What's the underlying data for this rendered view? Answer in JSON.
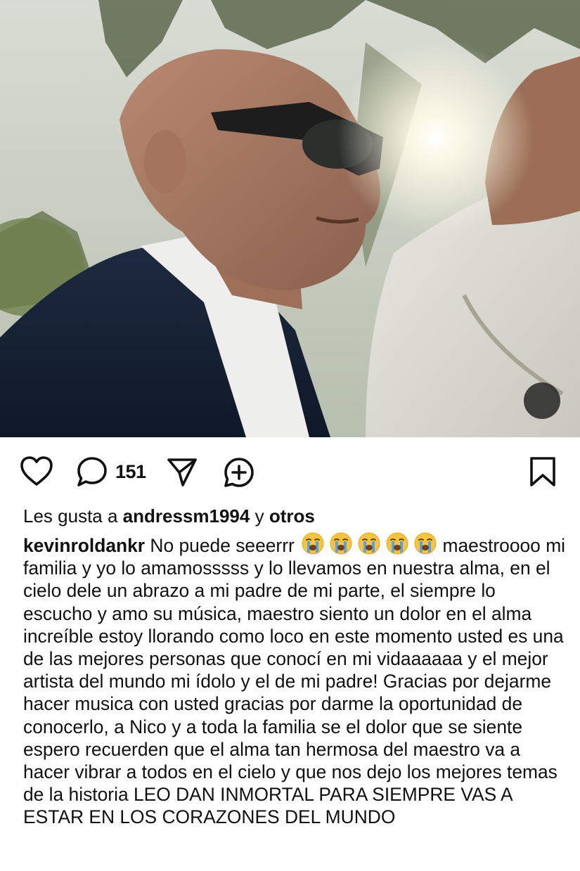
{
  "post": {
    "media": {
      "type": "video",
      "muted": true,
      "mute_icon": "speaker-muted-icon"
    },
    "actions": {
      "like_icon": "heart-icon",
      "comment_icon": "comment-bubble-icon",
      "comment_count": "151",
      "share_icon": "paper-plane-icon",
      "remix_icon": "add-circle-icon",
      "save_icon": "bookmark-icon"
    },
    "likes": {
      "prefix": "Les gusta a",
      "user": "andressm1994",
      "joiner": "y",
      "others": "otros"
    },
    "caption": {
      "username": "kevinroldankr",
      "lead": "No puede seeerrr",
      "emoji_name": "loudly-crying-face",
      "emoji_count": 5,
      "body": "maestroooo mi familia y yo lo amamosssss y lo llevamos en nuestra alma, en el cielo dele un abrazo a mi padre de mi parte, el siempre lo escucho y amo su música, maestro siento un dolor en el alma increíble estoy llorando como loco en este momento usted es una de las mejores personas que conocí en mi vidaaaaaa y el mejor artista del mundo mi ídolo y el de mi padre! Gracias por dejarme hacer musica con usted gracias por darme la oportunidad de conocerlo, a Nico y a toda la familia se el dolor que se siente espero recuerden que el alma tan hermosa del maestro va a hacer vibrar a todos en el cielo y que nos dejo los mejores temas de la historia LEO DAN INMORTAL PARA SIEMPRE VAS A ESTAR EN LOS CORAZONES DEL MUNDO"
    }
  }
}
